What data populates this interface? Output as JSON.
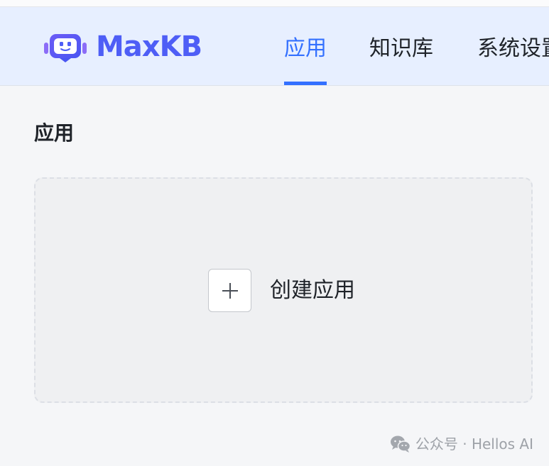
{
  "header": {
    "logo_text": "MaxKB",
    "nav": [
      {
        "label": "应用",
        "active": true
      },
      {
        "label": "知识库",
        "active": false
      },
      {
        "label": "系统设置",
        "active": false
      }
    ]
  },
  "main": {
    "title": "应用",
    "create_card": {
      "icon": "plus-icon",
      "label": "创建应用"
    }
  },
  "watermark": {
    "icon": "wechat-icon",
    "text": "公众号 · Hellos AI"
  },
  "colors": {
    "accent": "#3370ff",
    "logo": "#4e5ef6",
    "header_bg": "#e7efff",
    "page_bg": "#f5f6f8",
    "text": "#1f2329"
  }
}
